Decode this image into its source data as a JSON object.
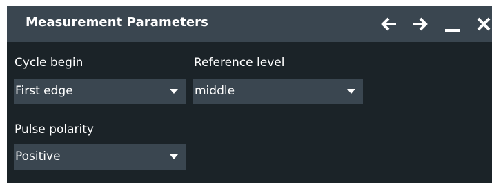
{
  "dialog": {
    "title": "Measurement Parameters",
    "buttons": {
      "back": "arrow-left-icon",
      "forward": "arrow-right-icon",
      "minimize": "minimize-icon",
      "close": "close-icon"
    }
  },
  "fields": {
    "cycle_begin": {
      "label": "Cycle begin",
      "value": "First edge"
    },
    "reference_level": {
      "label": "Reference level",
      "value": "middle"
    },
    "pulse_polarity": {
      "label": "Pulse polarity",
      "value": "Positive"
    }
  },
  "colors": {
    "background": "#1b2328",
    "titlebar": "#3a4650",
    "field": "#3a4650",
    "text": "#ffffff"
  }
}
